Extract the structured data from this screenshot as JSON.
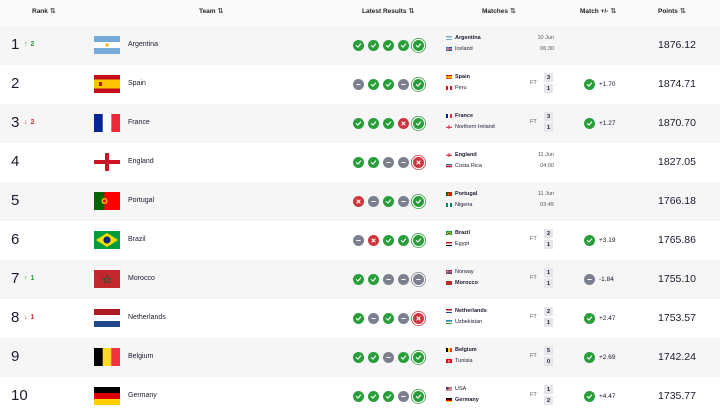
{
  "header": {
    "rank": "Rank",
    "team": "Team",
    "latest_results": "Latest Results",
    "matches": "Matches",
    "match_change": "Match +/-",
    "points": "Points"
  },
  "colors": {
    "win": "#2a9d3b",
    "draw": "#7b7f8e",
    "loss": "#d0343c"
  },
  "rows": [
    {
      "rank": "1",
      "move": {
        "dir": "up",
        "value": "2"
      },
      "team": "Argentina",
      "flag": "argentina",
      "results": [
        "W",
        "W",
        "W",
        "W",
        "W"
      ],
      "match": {
        "team1": "Argentina",
        "flag1": "argentina",
        "team2": "Iceland",
        "flag2": "iceland",
        "winner": 0,
        "status": "upcoming",
        "date": "10 Jun",
        "time": "06:30"
      },
      "change": null,
      "points": "1876.12"
    },
    {
      "rank": "2",
      "move": null,
      "team": "Spain",
      "flag": "spain",
      "results": [
        "D",
        "W",
        "W",
        "D",
        "W"
      ],
      "match": {
        "team1": "Spain",
        "flag1": "spain",
        "team2": "Peru",
        "flag2": "peru",
        "winner": 1,
        "status": "FT",
        "score1": "3",
        "score2": "1"
      },
      "change": {
        "dir": "up",
        "value": "+1.70"
      },
      "points": "1874.71"
    },
    {
      "rank": "3",
      "move": {
        "dir": "down",
        "value": "2"
      },
      "team": "France",
      "flag": "france",
      "results": [
        "W",
        "W",
        "W",
        "L",
        "W"
      ],
      "match": {
        "team1": "France",
        "flag1": "france",
        "team2": "Northern Ireland",
        "flag2": "northern-ireland",
        "winner": 1,
        "status": "FT",
        "score1": "3",
        "score2": "1"
      },
      "change": {
        "dir": "up",
        "value": "+1.27"
      },
      "points": "1870.70"
    },
    {
      "rank": "4",
      "move": null,
      "team": "England",
      "flag": "england",
      "results": [
        "W",
        "W",
        "D",
        "D",
        "L"
      ],
      "match": {
        "team1": "England",
        "flag1": "england",
        "team2": "Costa Rica",
        "flag2": "costa-rica",
        "winner": 0,
        "status": "upcoming",
        "date": "11 Jun",
        "time": "04:00"
      },
      "change": null,
      "points": "1827.05"
    },
    {
      "rank": "5",
      "move": null,
      "team": "Portugal",
      "flag": "portugal",
      "results": [
        "L",
        "D",
        "W",
        "D",
        "W"
      ],
      "match": {
        "team1": "Portugal",
        "flag1": "portugal",
        "team2": "Nigeria",
        "flag2": "nigeria",
        "winner": 0,
        "status": "upcoming",
        "date": "11 Jun",
        "time": "03:45"
      },
      "change": null,
      "points": "1766.18"
    },
    {
      "rank": "6",
      "move": null,
      "team": "Brazil",
      "flag": "brazil",
      "results": [
        "D",
        "L",
        "W",
        "W",
        "W"
      ],
      "match": {
        "team1": "Brazil",
        "flag1": "brazil",
        "team2": "Egypt",
        "flag2": "egypt",
        "winner": 1,
        "status": "FT",
        "score1": "2",
        "score2": "1"
      },
      "change": {
        "dir": "up",
        "value": "+3.19"
      },
      "points": "1765.86"
    },
    {
      "rank": "7",
      "move": {
        "dir": "up",
        "value": "1"
      },
      "team": "Morocco",
      "flag": "morocco",
      "results": [
        "W",
        "W",
        "D",
        "D",
        "D"
      ],
      "match": {
        "team1": "Norway",
        "flag1": "norway",
        "team2": "Morocco",
        "flag2": "morocco",
        "winner": 2,
        "status": "FT",
        "score1": "1",
        "score2": "1"
      },
      "change": {
        "dir": "down",
        "value": "-1.84"
      },
      "points": "1755.10"
    },
    {
      "rank": "8",
      "move": {
        "dir": "down",
        "value": "1"
      },
      "team": "Netherlands",
      "flag": "netherlands",
      "results": [
        "W",
        "D",
        "W",
        "D",
        "L"
      ],
      "match": {
        "team1": "Netherlands",
        "flag1": "netherlands",
        "team2": "Uzbekistan",
        "flag2": "uzbekistan",
        "winner": 1,
        "status": "FT",
        "score1": "2",
        "score2": "1"
      },
      "change": {
        "dir": "up",
        "value": "+2.47"
      },
      "points": "1753.57"
    },
    {
      "rank": "9",
      "move": null,
      "team": "Belgium",
      "flag": "belgium",
      "results": [
        "W",
        "W",
        "D",
        "W",
        "W"
      ],
      "match": {
        "team1": "Belgium",
        "flag1": "belgium",
        "team2": "Tunisia",
        "flag2": "tunisia",
        "winner": 1,
        "status": "FT",
        "score1": "5",
        "score2": "0"
      },
      "change": {
        "dir": "up",
        "value": "+2.69"
      },
      "points": "1742.24"
    },
    {
      "rank": "10",
      "move": null,
      "team": "Germany",
      "flag": "germany",
      "results": [
        "W",
        "W",
        "W",
        "D",
        "W"
      ],
      "match": {
        "team1": "USA",
        "flag1": "usa",
        "team2": "Germany",
        "flag2": "germany",
        "winner": 2,
        "status": "FT",
        "score1": "1",
        "score2": "2"
      },
      "change": {
        "dir": "up",
        "value": "+4.47"
      },
      "points": "1735.77"
    }
  ]
}
